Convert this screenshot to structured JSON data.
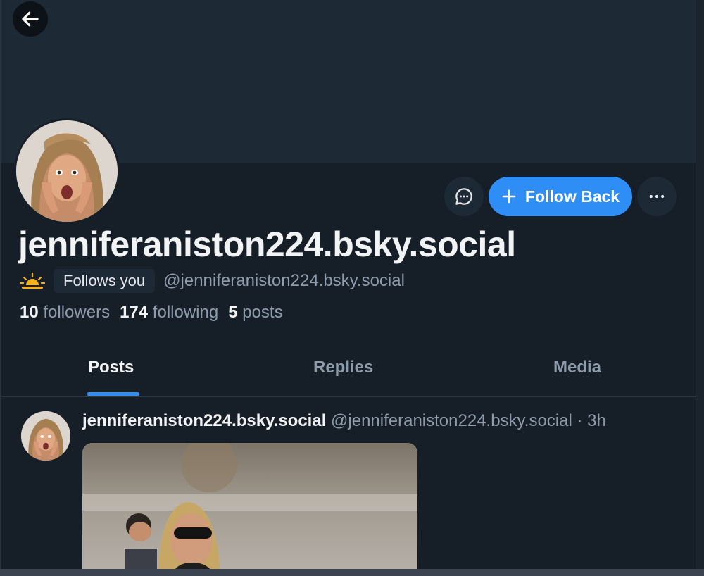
{
  "profile": {
    "display_name": "jenniferaniston224.bsky.social",
    "handle": "@jenniferaniston224.bsky.social",
    "follows_you": "Follows you",
    "emoji": "🌅",
    "followers_count": "10",
    "followers_label": "followers",
    "following_count": "174",
    "following_label": "following",
    "posts_count": "5",
    "posts_label": "posts"
  },
  "actions": {
    "follow_back_label": "Follow Back"
  },
  "tabs": [
    {
      "label": "Posts",
      "active": true
    },
    {
      "label": "Replies",
      "active": false
    },
    {
      "label": "Media",
      "active": false
    }
  ],
  "post": {
    "author_name": "jenniferaniston224.bsky.social",
    "author_handle": "@jenniferaniston224.bsky.social",
    "separator": "·",
    "time": "3h"
  },
  "colors": {
    "accent": "#2f8ef5",
    "background": "#161e27",
    "banner": "#1e2936",
    "muted_text": "#8d9bab"
  },
  "icons": [
    "back-arrow-icon",
    "chat-bubble-icon",
    "plus-icon",
    "more-dots-icon",
    "sunrise-emoji"
  ]
}
